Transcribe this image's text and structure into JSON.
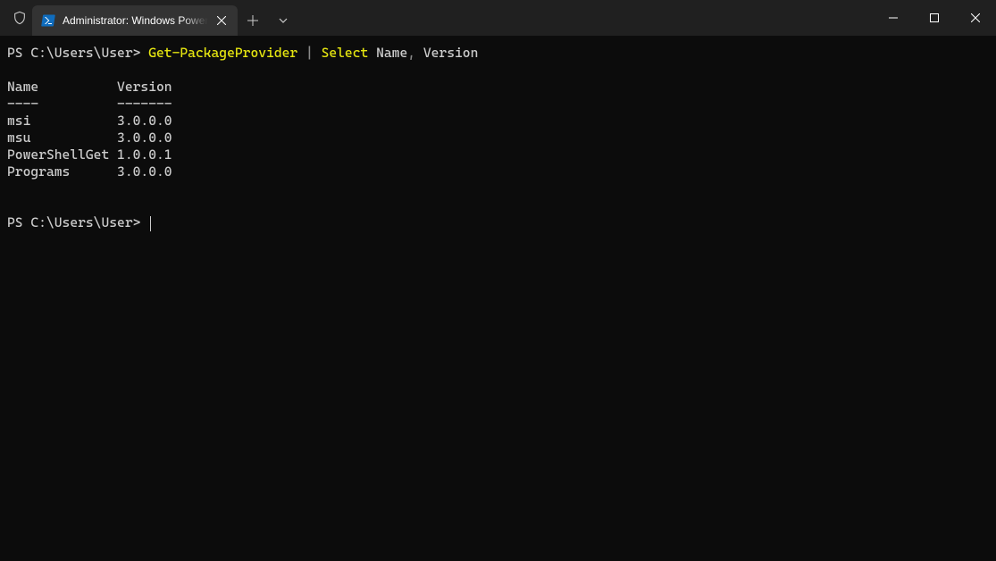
{
  "tab": {
    "title": "Administrator: Windows PowerShell"
  },
  "terminal": {
    "line1": {
      "prompt": "PS C:\\Users\\User> ",
      "cmd1": "Get-PackageProvider ",
      "pipe": "| ",
      "cmd2": "Select ",
      "args": "Name",
      "comma": ", ",
      "args2": "Version"
    },
    "blank1": "",
    "header": "Name          Version",
    "divider": "----          -------",
    "rows": [
      "msi           3.0.0.0",
      "msu           3.0.0.0",
      "PowerShellGet 1.0.0.1",
      "Programs      3.0.0.0"
    ],
    "blank2": "",
    "blank3": "",
    "prompt2": "PS C:\\Users\\User> "
  }
}
